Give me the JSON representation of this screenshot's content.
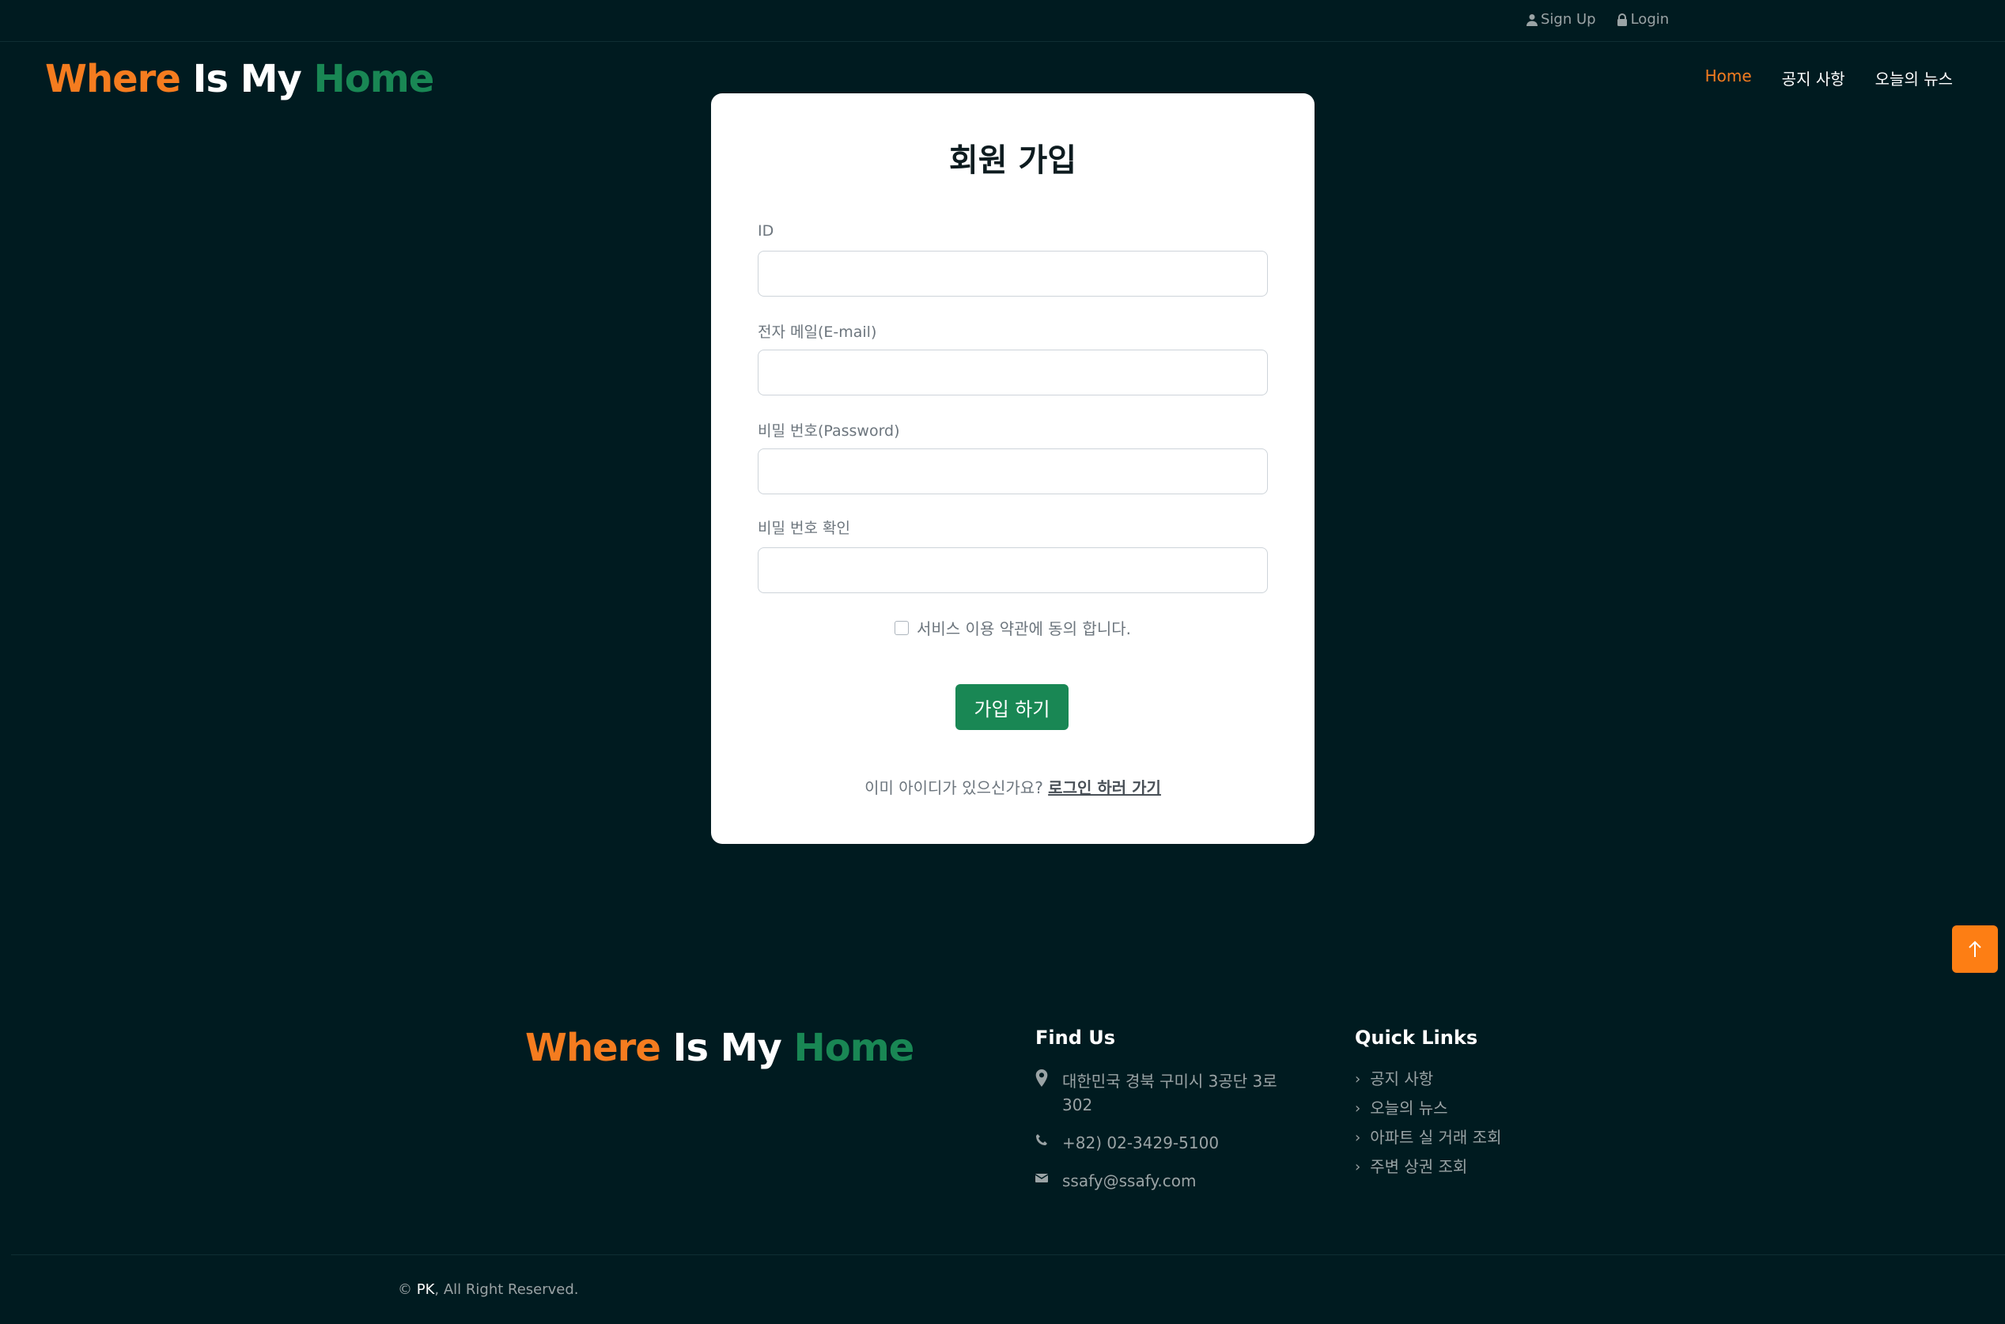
{
  "topbar": {
    "signup_label": "Sign Up",
    "login_label": "Login"
  },
  "logo": {
    "part1": "Where",
    "part2": "Is My",
    "part3": "Home"
  },
  "nav": {
    "items": [
      "Home",
      "공지 사항",
      "오늘의 뉴스"
    ]
  },
  "form": {
    "title": "회원 가입",
    "fields": [
      {
        "label": "ID",
        "value": ""
      },
      {
        "label": "전자 메일(E-mail)",
        "value": ""
      },
      {
        "label": "비밀 번호(Password)",
        "value": ""
      },
      {
        "label": "비밀 번호 확인",
        "value": ""
      }
    ],
    "agree_label": "서비스 이용 약관에 동의 합니다.",
    "submit_label": "가입 하기",
    "already_text": "이미 아이디가 있으신가요?",
    "login_link": "로그인 하러 가기"
  },
  "footer": {
    "find_title": "Find Us",
    "address": "대한민국 경북 구미시 3공단 3로 302",
    "phone": "+82) 02-3429-5100",
    "email": "ssafy@ssafy.com",
    "quick_title": "Quick Links",
    "quick_links": [
      "공지 사항",
      "오늘의 뉴스",
      "아파트 실 거래 조회",
      "주변 상권 조회"
    ],
    "copyright_prefix": "©",
    "copyright_name": "PK",
    "copyright_suffix": ", All Right Reserved."
  },
  "colors": {
    "background": "#001b20",
    "accent_orange": "#f57c1f",
    "accent_green": "#198754"
  },
  "icons": {
    "signup": "user-icon",
    "login": "lock-icon",
    "address": "map-marker-icon",
    "phone": "phone-icon",
    "email": "envelope-icon",
    "quick_link": "chevron-right-icon",
    "to_top": "arrow-up-icon"
  }
}
